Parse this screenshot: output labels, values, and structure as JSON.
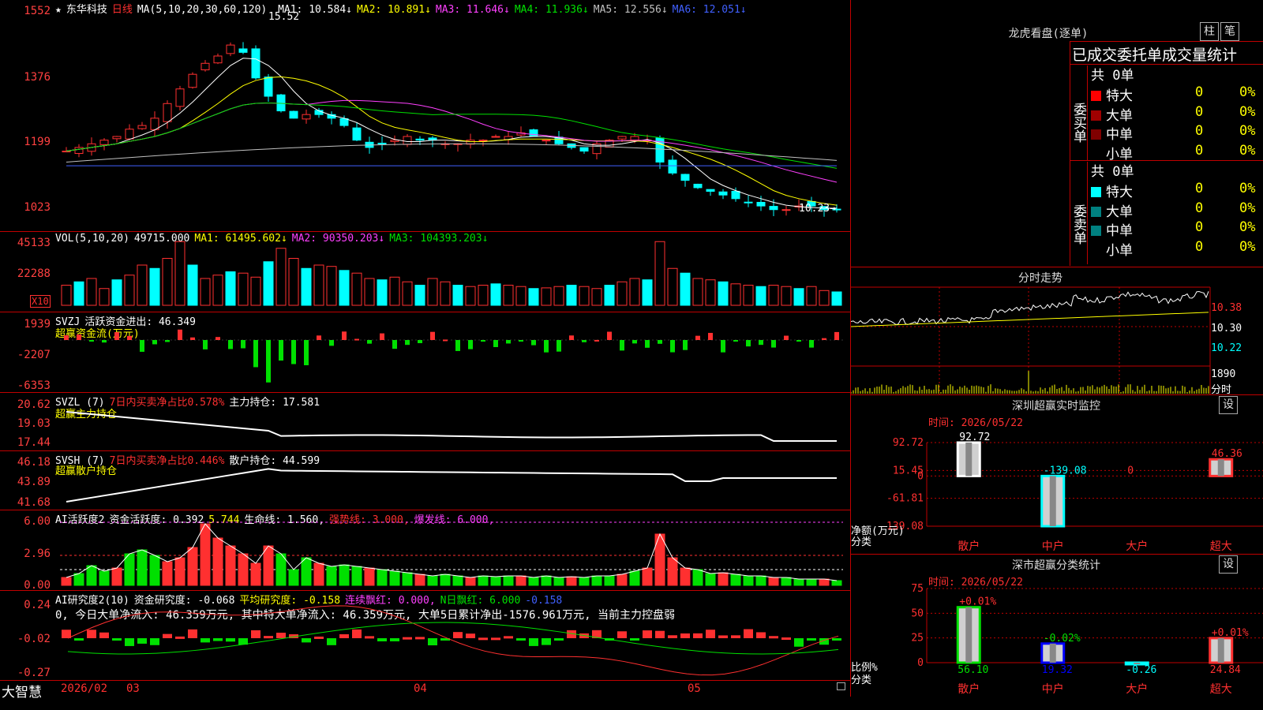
{
  "stock_name": "东华科技",
  "period": "日线",
  "brand": "大智慧",
  "kline": {
    "ma_label": "MA(5,10,20,30,60,120)",
    "ma": [
      {
        "name": "MA1",
        "value": "10.584",
        "arrow": "↓",
        "color": "#ffffff"
      },
      {
        "name": "MA2",
        "value": "10.891",
        "arrow": "↓",
        "color": "#ffff00"
      },
      {
        "name": "MA3",
        "value": "11.646",
        "arrow": "↓",
        "color": "#ff40ff"
      },
      {
        "name": "MA4",
        "value": "11.936",
        "arrow": "↓",
        "color": "#00e000"
      },
      {
        "name": "MA5",
        "value": "12.556",
        "arrow": "↓",
        "color": "#c0c0c0"
      },
      {
        "name": "MA6",
        "value": "12.051",
        "arrow": "↓",
        "color": "#4060ff"
      }
    ],
    "high_mark": "15.52",
    "low_mark": "10.23",
    "axis": [
      "1552",
      "1376",
      "1199",
      "1023"
    ]
  },
  "vol": {
    "label": "VOL(5,10,20)",
    "value": "49715.000",
    "ma": [
      {
        "name": "MA1",
        "value": "61495.602",
        "color": "#ffff00"
      },
      {
        "name": "MA2",
        "value": "90350.203",
        "color": "#ff40ff"
      },
      {
        "name": "MA3",
        "value": "104393.203",
        "color": "#00e000"
      }
    ],
    "axis": [
      "45133",
      "22288"
    ],
    "unit": "X10"
  },
  "svzj": {
    "name": "SVZJ",
    "line1": "活跃资金进出: 46.349",
    "line2": "超赢资金流(万元)",
    "axis": [
      "1939",
      "-2207",
      "-6353"
    ]
  },
  "svzl": {
    "name": "SVZL (7)",
    "seg1": "7日内买卖净占比0.578%",
    "seg2": "主力持仓: 17.581",
    "line2": "超赢主力持仓",
    "axis": [
      "20.62",
      "19.03",
      "17.44"
    ]
  },
  "svsh": {
    "name": "SVSH (7)",
    "seg1": "7日内买卖净占比0.446%",
    "seg2": "散户持仓: 44.599",
    "line2": "超赢散户持仓",
    "axis": [
      "46.18",
      "43.89",
      "41.68"
    ]
  },
  "ai1": {
    "name": "AI活跃度2",
    "seg1": "资金活跃度: 0.392",
    "seg2": "5.744",
    "seg3": "生命线: 1.560,",
    "seg4": "强势线: 3.000,",
    "seg5": "爆发线: 6.000,",
    "axis": [
      "6.00",
      "2.96",
      "0.00"
    ]
  },
  "ai2": {
    "name": "AI研究度2(10)",
    "seg1": "资金研究度: -0.068",
    "seg2": "平均研究度: -0.158",
    "seg3": "连续飘红: 0.000,",
    "seg4": "N日飘红: 6.000",
    "seg5": "-0.158",
    "line2": "0, 今日大单净流入: 46.359万元, 其中特大单净流入: 46.359万元, 大单5日累计净出-1576.961万元, 当前主力控盘弱",
    "axis": [
      "0.24",
      "-0.02",
      "-0.27"
    ]
  },
  "dates": [
    "2026/02",
    "03",
    "04",
    "05"
  ],
  "lhb": {
    "title": "龙虎看盘(逐单)",
    "btn1": "柱",
    "btn2": "笔",
    "heading": "已成交委托单成交量统计",
    "buy_label": "委买单",
    "sell_label": "委卖单",
    "buy_total": "共 0单",
    "sell_total": "共 0单",
    "buy_rows": [
      {
        "name": "特大",
        "val": "0",
        "pct": "0%",
        "color": "#ff0000"
      },
      {
        "name": "大单",
        "val": "0",
        "pct": "0%",
        "color": "#a00000"
      },
      {
        "name": "中单",
        "val": "0",
        "pct": "0%",
        "color": "#800000"
      },
      {
        "name": "小单",
        "val": "0",
        "pct": "0%",
        "color": ""
      }
    ],
    "sell_rows": [
      {
        "name": "特大",
        "val": "0",
        "pct": "0%",
        "color": "#00ffff"
      },
      {
        "name": "大单",
        "val": "0",
        "pct": "0%",
        "color": "#008080"
      },
      {
        "name": "中单",
        "val": "0",
        "pct": "0%",
        "color": "#008080"
      },
      {
        "name": "小单",
        "val": "0",
        "pct": "0%",
        "color": ""
      }
    ]
  },
  "fenshi": {
    "title": "分时走势",
    "axis": [
      "10.38",
      "10.30",
      "10.22"
    ],
    "vol_axis": "1890",
    "vol_unit": "分时"
  },
  "sz_monitor": {
    "title": "深圳超赢实时监控",
    "btn": "设",
    "time": "时间: 2026/05/22",
    "axis": [
      "92.72",
      "15.45",
      "0",
      "-61.81",
      "-139.08"
    ],
    "y_unit": "净额(万元)",
    "x_unit": "分类",
    "categories": [
      "散户",
      "中户",
      "大户",
      "超大"
    ],
    "bar_labels": [
      "92.72",
      "-139.08",
      "0",
      "46.36"
    ]
  },
  "sz_stats": {
    "title": "深市超赢分类统计",
    "btn": "设",
    "time": "时间: 2026/05/22",
    "axis": [
      "75",
      "50",
      "25",
      "0"
    ],
    "y_unit": "比例%",
    "x_unit": "分类",
    "categories": [
      "散户",
      "中户",
      "大户",
      "超大"
    ],
    "bar_tops": [
      "+0.01%",
      "-0.02%",
      "",
      "+0.01%"
    ],
    "bar_values": [
      "56.10",
      "19.32",
      "-0.26",
      "24.84"
    ]
  },
  "chart_data": [
    {
      "type": "bar",
      "title": "深圳超赢实时监控",
      "ylabel": "净额(万元)",
      "xlabel": "分类",
      "categories": [
        "散户",
        "中户",
        "大户",
        "超大"
      ],
      "values": [
        92.72,
        -139.08,
        0,
        46.36
      ],
      "ylim": [
        -139.08,
        92.72
      ]
    },
    {
      "type": "bar",
      "title": "深市超赢分类统计",
      "ylabel": "比例%",
      "xlabel": "分类",
      "categories": [
        "散户",
        "中户",
        "大户",
        "超大"
      ],
      "values": [
        56.1,
        19.32,
        -0.26,
        24.84
      ],
      "ylim": [
        0,
        75
      ]
    }
  ]
}
